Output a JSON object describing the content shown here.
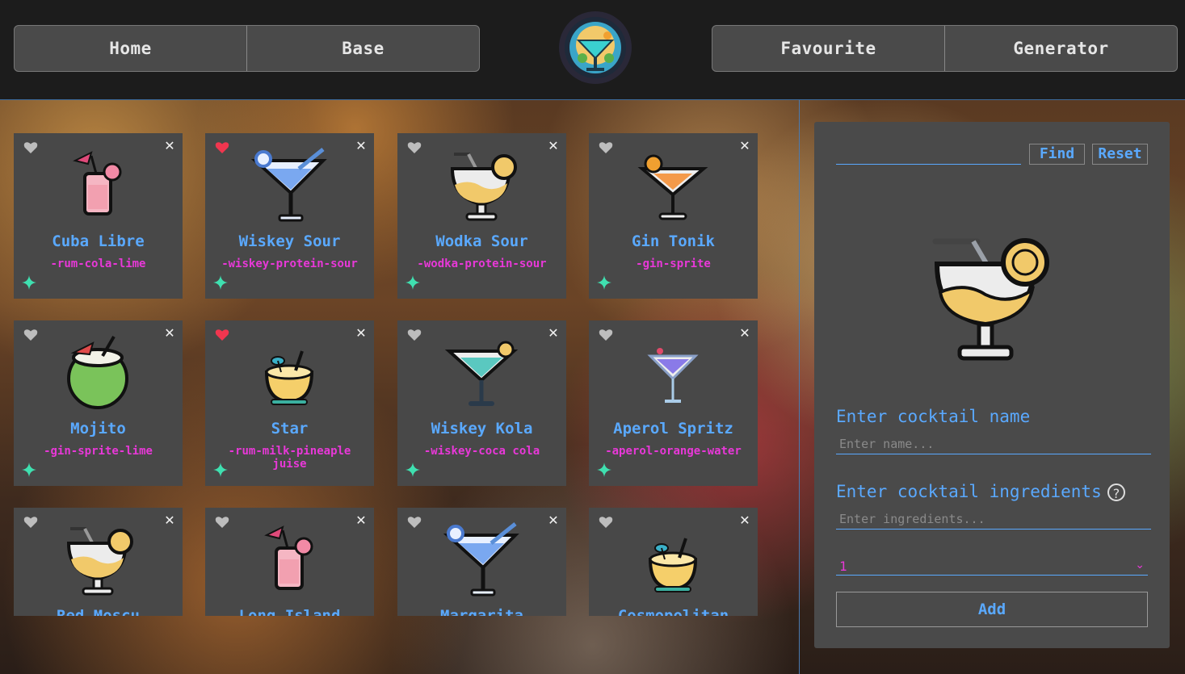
{
  "nav": {
    "left": [
      "Home",
      "Base"
    ],
    "right": [
      "Favourite",
      "Generator"
    ]
  },
  "cards": [
    {
      "name": "Cuba Libre",
      "ingredients": "-rum-cola-lime",
      "favourite": false,
      "icon": "pink-cocktail-icon"
    },
    {
      "name": "Wiskey Sour",
      "ingredients": "-wiskey-protein-sour",
      "favourite": true,
      "icon": "blue-martini-icon"
    },
    {
      "name": "Wodka Sour",
      "ingredients": "-wodka-protein-sour",
      "favourite": false,
      "icon": "lemon-glass-icon"
    },
    {
      "name": "Gin Tonik",
      "ingredients": "-gin-sprite",
      "favourite": false,
      "icon": "orange-martini-icon"
    },
    {
      "name": "Mojito",
      "ingredients": "-gin-sprite-lime",
      "favourite": false,
      "icon": "coconut-icon"
    },
    {
      "name": "Star",
      "ingredients": "-rum-milk-pineaple juise",
      "favourite": true,
      "icon": "pineapple-icon"
    },
    {
      "name": "Wiskey Kola",
      "ingredients": "-wiskey-coca cola",
      "favourite": false,
      "icon": "teal-martini-icon"
    },
    {
      "name": "Aperol Spritz",
      "ingredients": "-aperol-orange-water",
      "favourite": false,
      "icon": "purple-martini-icon"
    },
    {
      "name": "Red Moscu",
      "ingredients": "",
      "favourite": false,
      "icon": "lemon-glass-icon"
    },
    {
      "name": "Long Island",
      "ingredients": "",
      "favourite": false,
      "icon": "pink-cocktail-icon"
    },
    {
      "name": "Margarita",
      "ingredients": "",
      "favourite": false,
      "icon": "blue-martini-icon"
    },
    {
      "name": "Cosmopolitan",
      "ingredients": "",
      "favourite": false,
      "icon": "pineapple-icon"
    }
  ],
  "panel": {
    "find_label": "Find",
    "reset_label": "Reset",
    "name_label": "Enter cocktail name",
    "name_placeholder": "Enter name...",
    "ingredients_label": "Enter cocktail ingredients",
    "ingredients_placeholder": "Enter ingredients...",
    "select_value": "1",
    "add_label": "Add"
  },
  "colors": {
    "accent": "#5aa9ff",
    "ingredients": "#e838d8",
    "heart_active": "#f0364f",
    "sparkle": "#3fe0b0"
  }
}
